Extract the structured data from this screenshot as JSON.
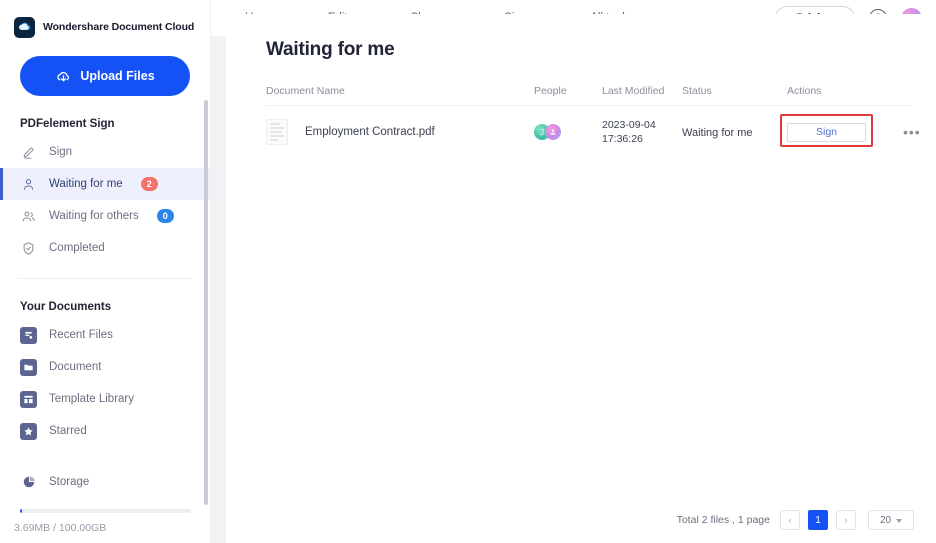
{
  "brand": {
    "name": "Wondershare Document Cloud",
    "logo_icon": "cloud-logo-icon"
  },
  "sidebar": {
    "upload_button": {
      "label": "Upload Files",
      "icon": "cloud-upload-icon"
    },
    "sign_section": {
      "title": "PDFelement Sign",
      "items": [
        {
          "label": "Sign",
          "icon": "pen-icon",
          "badge": null,
          "active": false
        },
        {
          "label": "Waiting for me",
          "icon": "user-icon",
          "badge": "2",
          "badge_color": "#f4736b",
          "active": true
        },
        {
          "label": "Waiting for others",
          "icon": "users-icon",
          "badge": "0",
          "badge_color": "#2c86e8",
          "active": false
        },
        {
          "label": "Completed",
          "icon": "shield-check-icon",
          "badge": null,
          "active": false
        }
      ]
    },
    "documents_section": {
      "title": "Your Documents",
      "items": [
        {
          "label": "Recent Files",
          "icon": "recent-files-icon"
        },
        {
          "label": "Document",
          "icon": "folder-icon"
        },
        {
          "label": "Template Library",
          "icon": "template-icon"
        },
        {
          "label": "Starred",
          "icon": "star-icon"
        }
      ]
    },
    "storage": {
      "label": "Storage",
      "icon": "pie-chart-icon",
      "usage_text": "3.69MB / 100.00GB",
      "used_percent": 1
    }
  },
  "topbar": {
    "nav": [
      {
        "label": "Home",
        "has_caret": false
      },
      {
        "label": "Edit",
        "has_caret": true
      },
      {
        "label": "Share",
        "has_caret": true
      },
      {
        "label": "Sign",
        "has_caret": true
      },
      {
        "label": "All tools",
        "has_caret": false
      }
    ],
    "pricing_label": "Pricing",
    "help_icon": "question-mark-icon",
    "help_glyph": "?",
    "avatar_icon": "user-avatar-icon"
  },
  "main": {
    "title": "Waiting for me",
    "table": {
      "columns": {
        "document_name": "Document Name",
        "people": "People",
        "last_modified": "Last Modified",
        "status": "Status",
        "actions": "Actions"
      },
      "rows": [
        {
          "file_icon": "document-file-icon",
          "name": "Employment Contract.pdf",
          "people": [
            {
              "initial": "J",
              "color": "#3cc3a5"
            },
            {
              "initial": "",
              "color": "#c78ae8"
            }
          ],
          "date_line1": "2023-09-04",
          "date_line2": "17:36:26",
          "status": "Waiting for me",
          "action_label": "Sign",
          "more_glyph": "•••",
          "highlighted": true
        }
      ]
    },
    "pagination": {
      "total_text": "Total 2 files , 1 page",
      "prev_glyph": "‹",
      "next_glyph": "›",
      "current_page": "1",
      "page_size": "20",
      "page_size_caret": "⌄"
    }
  },
  "colors": {
    "accent": "#1452f5",
    "active_nav_bg": "#eef1fb",
    "highlight_red": "#e03a3a",
    "link_blue": "#4a6fd4"
  }
}
